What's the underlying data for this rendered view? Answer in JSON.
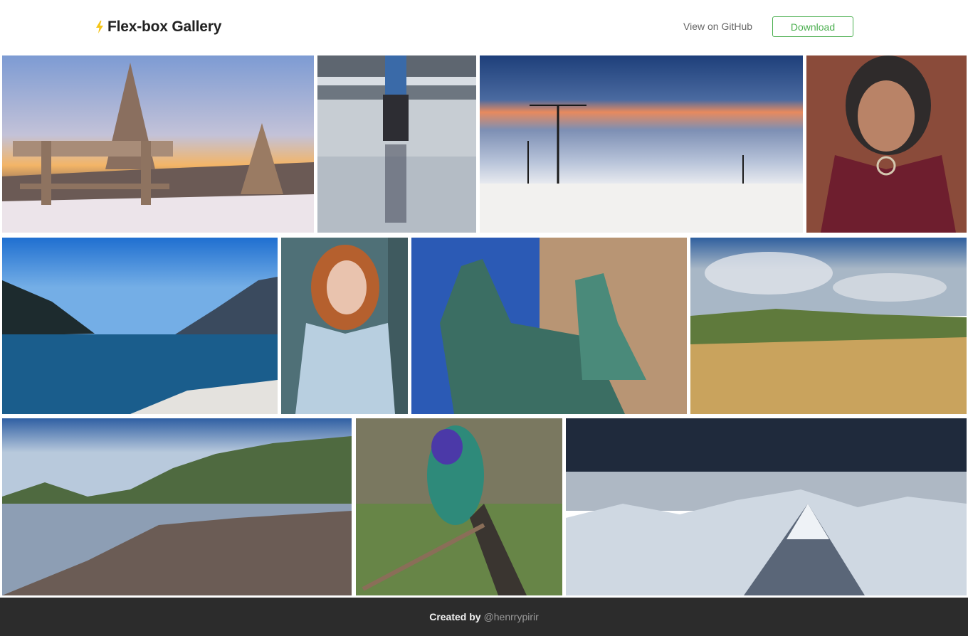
{
  "header": {
    "title": "Flex-box Gallery",
    "github_link": "View on GitHub",
    "download_button": "Download",
    "accent_color": "#4caf50",
    "bolt_color": "#f5c518"
  },
  "gallery": {
    "rows": [
      {
        "tiles": [
          {
            "subject": "snowy bench and trees at sunset"
          },
          {
            "subject": "surfer walking on beach"
          },
          {
            "subject": "wind turbines above fog"
          },
          {
            "subject": "portrait of elderly woman"
          }
        ]
      },
      {
        "tiles": [
          {
            "subject": "blue lake with mountains"
          },
          {
            "subject": "red-haired woman in denim jacket"
          },
          {
            "subject": "equestrian statue"
          },
          {
            "subject": "rolling fields under clouds"
          }
        ]
      },
      {
        "tiles": [
          {
            "subject": "rocky coastline"
          },
          {
            "subject": "hummingbird on branch"
          },
          {
            "subject": "snowy mountain range"
          }
        ]
      }
    ]
  },
  "footer": {
    "created_by": "Created by",
    "handle": "@henrrypirir"
  }
}
